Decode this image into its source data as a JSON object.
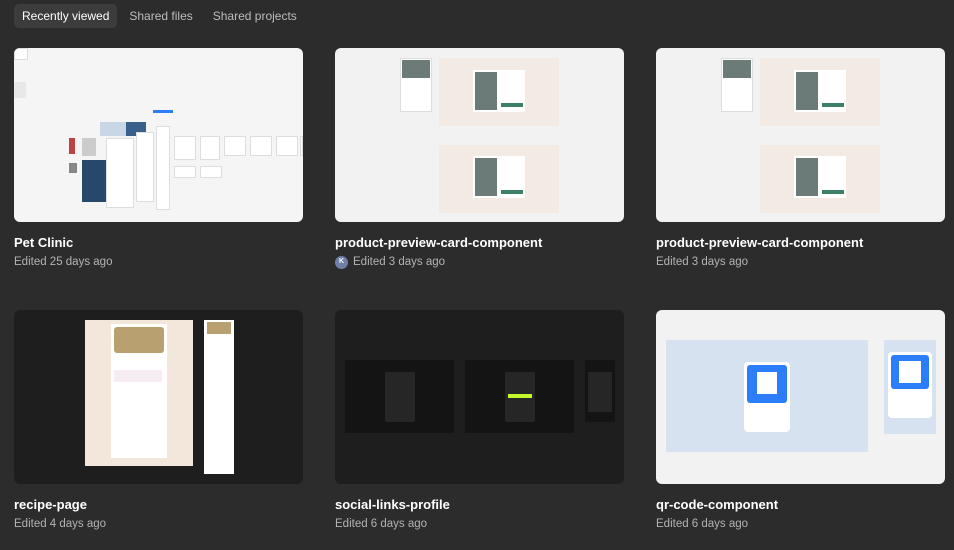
{
  "tabs": [
    {
      "label": "Recently viewed",
      "active": true
    },
    {
      "label": "Shared files",
      "active": false
    },
    {
      "label": "Shared projects",
      "active": false
    }
  ],
  "files": [
    {
      "name": "Pet Clinic",
      "edited": "Edited 25 days ago",
      "avatar": ""
    },
    {
      "name": "product-preview-card-component",
      "edited": "Edited 3 days ago",
      "avatar": "K"
    },
    {
      "name": "product-preview-card-component",
      "edited": "Edited 3 days ago",
      "avatar": ""
    },
    {
      "name": "recipe-page",
      "edited": "Edited 4 days ago",
      "avatar": ""
    },
    {
      "name": "social-links-profile",
      "edited": "Edited 6 days ago",
      "avatar": ""
    },
    {
      "name": "qr-code-component",
      "edited": "Edited 6 days ago",
      "avatar": ""
    }
  ],
  "colors": {
    "background": "#2c2c2c",
    "thumb_light": "#f5f5f5",
    "thumb_dark": "#1e1e1e",
    "qr_blue": "#2c7dfa",
    "product_bg": "#f3ebe3",
    "recipe_bg": "#f3e6da",
    "qr_bg": "#d6e2f0"
  }
}
